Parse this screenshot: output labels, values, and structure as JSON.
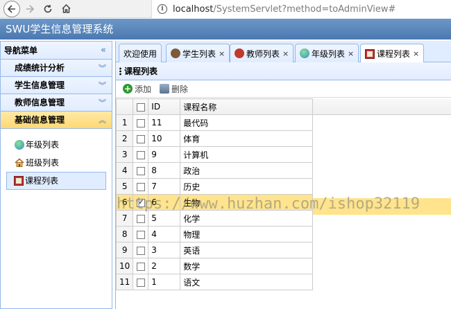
{
  "browser": {
    "url_host": "localhost",
    "url_path": "/SystemServlet?method=toAdminView#"
  },
  "app": {
    "title": "SWU学生信息管理系统"
  },
  "sidebar": {
    "title": "导航菜单",
    "sections": [
      {
        "label": "成绩统计分析",
        "active": false
      },
      {
        "label": "学生信息管理",
        "active": false
      },
      {
        "label": "教师信息管理",
        "active": false
      },
      {
        "label": "基础信息管理",
        "active": true
      }
    ],
    "items": [
      {
        "label": "年级列表",
        "icon": "globe-icon"
      },
      {
        "label": "班级列表",
        "icon": "house-icon"
      },
      {
        "label": "课程列表",
        "icon": "book-icon",
        "selected": true
      }
    ]
  },
  "tabs": [
    {
      "label": "欢迎使用",
      "closable": false
    },
    {
      "label": "学生列表",
      "closable": true,
      "icon": "student-icon"
    },
    {
      "label": "教师列表",
      "closable": true,
      "icon": "teacher-icon"
    },
    {
      "label": "年级列表",
      "closable": true,
      "icon": "globe-icon"
    },
    {
      "label": "课程列表",
      "closable": true,
      "icon": "book-icon",
      "active": true
    }
  ],
  "panel": {
    "title": "课程列表",
    "toolbar": {
      "add_label": "添加",
      "delete_label": "删除"
    },
    "columns": [
      "ID",
      "课程名称"
    ],
    "rows": [
      {
        "rn": "1",
        "id": "11",
        "name": "最代码",
        "checked": false
      },
      {
        "rn": "2",
        "id": "10",
        "name": "体育",
        "checked": false
      },
      {
        "rn": "3",
        "id": "9",
        "name": "计算机",
        "checked": false
      },
      {
        "rn": "4",
        "id": "8",
        "name": "政治",
        "checked": false
      },
      {
        "rn": "5",
        "id": "7",
        "name": "历史",
        "checked": false
      },
      {
        "rn": "6",
        "id": "6",
        "name": "生物",
        "checked": true
      },
      {
        "rn": "7",
        "id": "5",
        "name": "化学",
        "checked": false
      },
      {
        "rn": "8",
        "id": "4",
        "name": "物理",
        "checked": false
      },
      {
        "rn": "9",
        "id": "3",
        "name": "英语",
        "checked": false
      },
      {
        "rn": "10",
        "id": "2",
        "name": "数学",
        "checked": false
      },
      {
        "rn": "11",
        "id": "1",
        "name": "语文",
        "checked": false
      }
    ]
  },
  "watermark": "https://www.huzhan.com/ishop32119",
  "colors": {
    "header": "#4a78b0",
    "border": "#95b8e7",
    "selected_row": "#ffe48d"
  }
}
